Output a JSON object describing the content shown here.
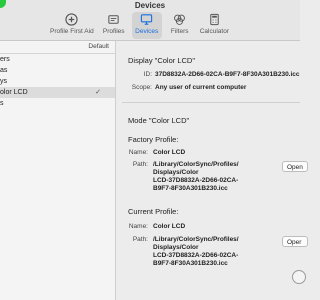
{
  "window": {
    "title": "Devices"
  },
  "toolbar": {
    "items": [
      {
        "label": "Profile First Aid",
        "icon": "plus-circle-icon"
      },
      {
        "label": "Profiles",
        "icon": "profiles-icon"
      },
      {
        "label": "Devices",
        "icon": "monitor-icon",
        "active": true
      },
      {
        "label": "Filters",
        "icon": "filters-icon"
      },
      {
        "label": "Calculator",
        "icon": "calculator-icon"
      }
    ]
  },
  "sidebar": {
    "header_default": "Default",
    "rows": [
      {
        "label": "ers"
      },
      {
        "label": "as"
      },
      {
        "label": "ys"
      },
      {
        "label": "olor LCD",
        "selected": true,
        "check": "✓"
      },
      {
        "label": "s"
      }
    ]
  },
  "display": {
    "title": "Display \"Color LCD\"",
    "id_label": "ID:",
    "id_value": "37D8832A-2D66-02CA-B9F7-8F30A301B230.icc",
    "scope_label": "Scope:",
    "scope_value": "Any user of current computer"
  },
  "mode": {
    "title": "Mode \"Color LCD\""
  },
  "factory": {
    "title": "Factory Profile:",
    "name_label": "Name:",
    "name_value": "Color LCD",
    "path_label": "Path:",
    "path_lines": [
      "/Library/ColorSync/Profiles/",
      "Displays/Color",
      "LCD-37D8832A-2D66-02CA-",
      "B9F7-8F30A301B230.icc"
    ],
    "open_label": "Open"
  },
  "current": {
    "title": "Current Profile:",
    "name_label": "Name:",
    "name_value": "Color LCD",
    "path_label": "Path:",
    "path_lines": [
      "/Library/ColorSync/Profiles/",
      "Displays/Color",
      "LCD-37D8832A-2D66-02CA-",
      "B9F7-8F30A301B230.icc"
    ],
    "open_label": "Oper"
  }
}
